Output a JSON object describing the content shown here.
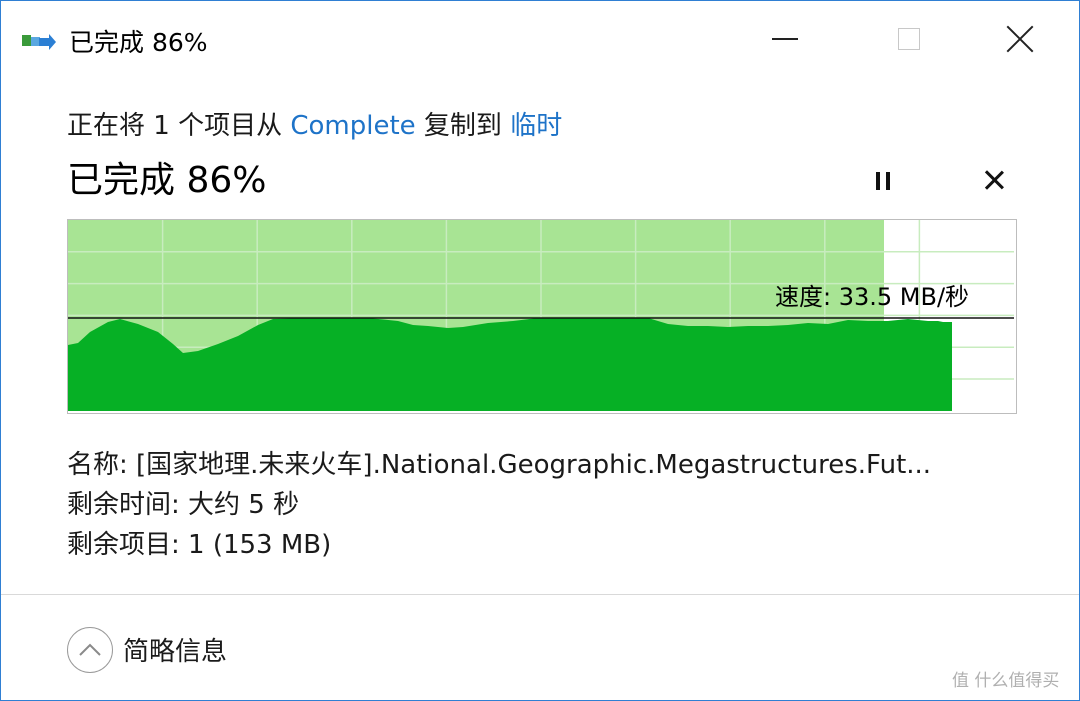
{
  "window": {
    "title": "已完成 86%",
    "icon": "copy-transfer-icon"
  },
  "transfer": {
    "prefix": "正在将 1 个项目从",
    "source": "Complete",
    "middle": "复制到",
    "destination": "临时",
    "heading": "已完成 86%",
    "progress_fraction": 0.86,
    "speed_label": "速度: 33.5 MB/秒"
  },
  "details": {
    "name": "名称:  [国家地理.未来火车].National.Geographic.Megastructures.Fut...",
    "time_remaining": "剩余时间:  大约 5 秒",
    "items_remaining": "剩余项目:  1 (153 MB)"
  },
  "footer": {
    "toggle_label": "简略信息"
  },
  "colors": {
    "graph_bg_fill": "#a8e494",
    "graph_speed_fill": "#06b025",
    "graph_grid": "#c8ecbf",
    "link": "#1e73c8"
  },
  "watermark": "值 什么值得买"
}
